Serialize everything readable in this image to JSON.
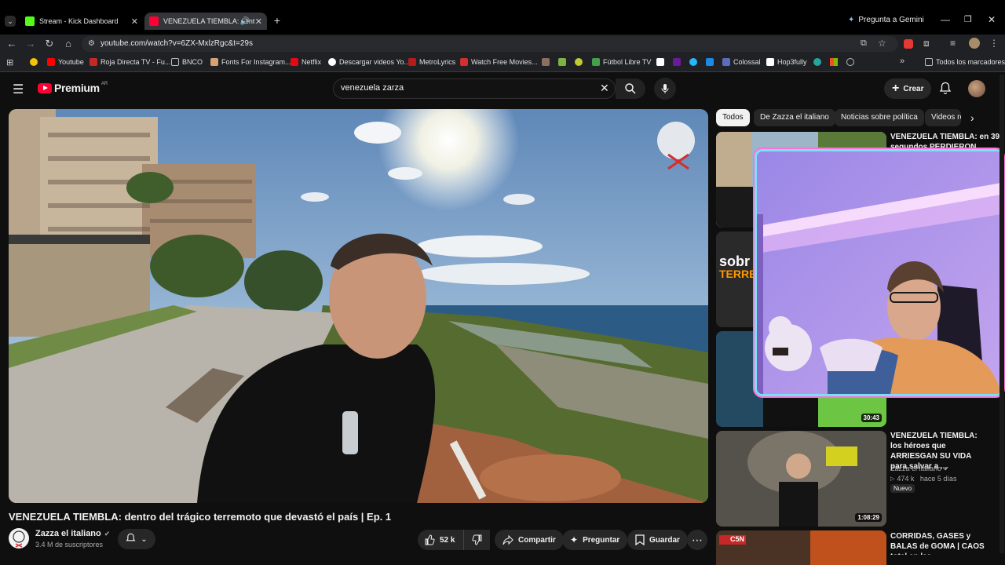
{
  "browser": {
    "tabs": [
      {
        "label": "Stream - Kick Dashboard",
        "active": false
      },
      {
        "label": "VENEZUELA TIEMBLA: dent",
        "active": true
      }
    ],
    "gemini_label": "Pregunta a Gemini",
    "url": "youtube.com/watch?v=6ZX-MxlzRgc&t=29s",
    "bookmarks": [
      "Youtube",
      "Roja Directa TV - Fu...",
      "BNCO",
      "Fonts For Instagram...",
      "Netflix",
      "Descargar videos Yo...",
      "MetroLyrics",
      "Watch Free Movies...",
      "Fútbol Libre TV",
      "Colossal",
      "Hop3fully"
    ],
    "all_bookmarks": "Todos los marcadores"
  },
  "youtube": {
    "logo_text": "Premium",
    "logo_region": "AR",
    "search_value": "venezuela zarza",
    "create_label": "Crear"
  },
  "video": {
    "title": "VENEZUELA TIEMBLA: dentro del trágico terremoto que devastó el país | Ep. 1 ᴠᴇ",
    "channel": "Zazza el italiano",
    "subscribers": "3.4 M de suscriptores",
    "likes": "52 k",
    "share_label": "Compartir",
    "ask_label": "Preguntar",
    "save_label": "Guardar"
  },
  "chips": [
    "Todos",
    "De Zazza el italiano",
    "Noticias sobre política",
    "Videos re"
  ],
  "sidebar": [
    {
      "title_line1": "VENEZUELA TIEMBLA: en 39",
      "title_line2": "segundos PERDIERON"
    },
    {
      "thumb_text_1": "sobr",
      "thumb_text_2": "TERREM"
    },
    {
      "duration": "30:43"
    },
    {
      "title": "VENEZUELA TIEMBLA: los héroes que ARRIESGAN SU VIDA para salvar a ...",
      "channel": "Zazza el italiano",
      "meta": "474 k   hace 5 días",
      "badge": "Nuevo",
      "duration": "1:08:29"
    },
    {
      "title": "CORRIDAS, GASES y BALAS de GOMA | CAOS total en las",
      "thumb_text": "C5N"
    }
  ]
}
